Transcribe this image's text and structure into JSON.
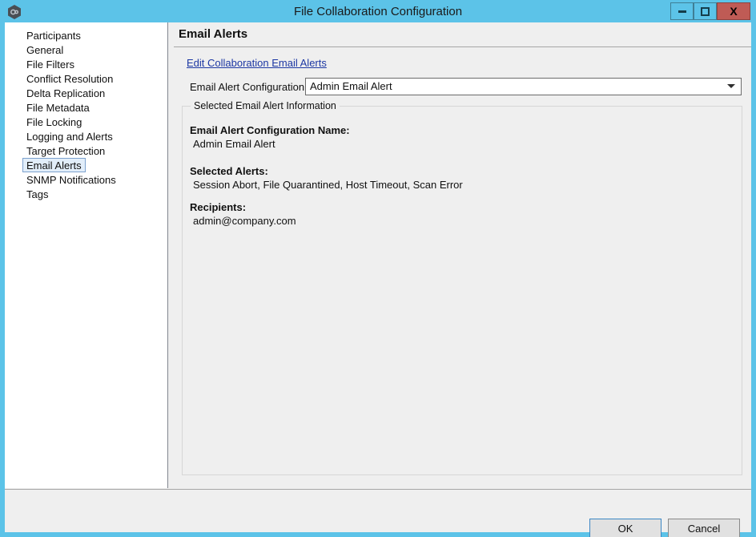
{
  "window": {
    "title": "File Collaboration Configuration",
    "app_icon": "link-hexagon-icon",
    "accent_color": "#5cc3e8",
    "controls": {
      "minimize_label": "–",
      "maximize_label": "□",
      "close_label": "X",
      "close_color": "#bf5b55"
    }
  },
  "sidebar": {
    "items": [
      {
        "label": "Participants",
        "selected": false
      },
      {
        "label": "General",
        "selected": false
      },
      {
        "label": "File Filters",
        "selected": false
      },
      {
        "label": "Conflict Resolution",
        "selected": false
      },
      {
        "label": "Delta Replication",
        "selected": false
      },
      {
        "label": "File Metadata",
        "selected": false
      },
      {
        "label": "File Locking",
        "selected": false
      },
      {
        "label": "Logging and Alerts",
        "selected": false
      },
      {
        "label": "Target Protection",
        "selected": false
      },
      {
        "label": "Email Alerts",
        "selected": true
      },
      {
        "label": "SNMP Notifications",
        "selected": false
      },
      {
        "label": "Tags",
        "selected": false
      }
    ]
  },
  "main": {
    "title": "Email Alerts",
    "edit_link": "Edit Collaboration Email Alerts",
    "combo_label": "Email Alert Configuration:",
    "combo_value": "Admin Email Alert",
    "combo_arrow_icon": "chevron-down-icon",
    "group": {
      "legend": "Selected Email Alert Information",
      "name_heading": "Email Alert Configuration Name:",
      "name_value": "Admin Email Alert",
      "alerts_heading": "Selected Alerts:",
      "alerts_value": "Session Abort, File Quarantined, Host Timeout, Scan Error",
      "recipients_heading": "Recipients:",
      "recipients_value": "admin@company.com"
    }
  },
  "footer": {
    "ok_label": "OK",
    "cancel_label": "Cancel"
  }
}
